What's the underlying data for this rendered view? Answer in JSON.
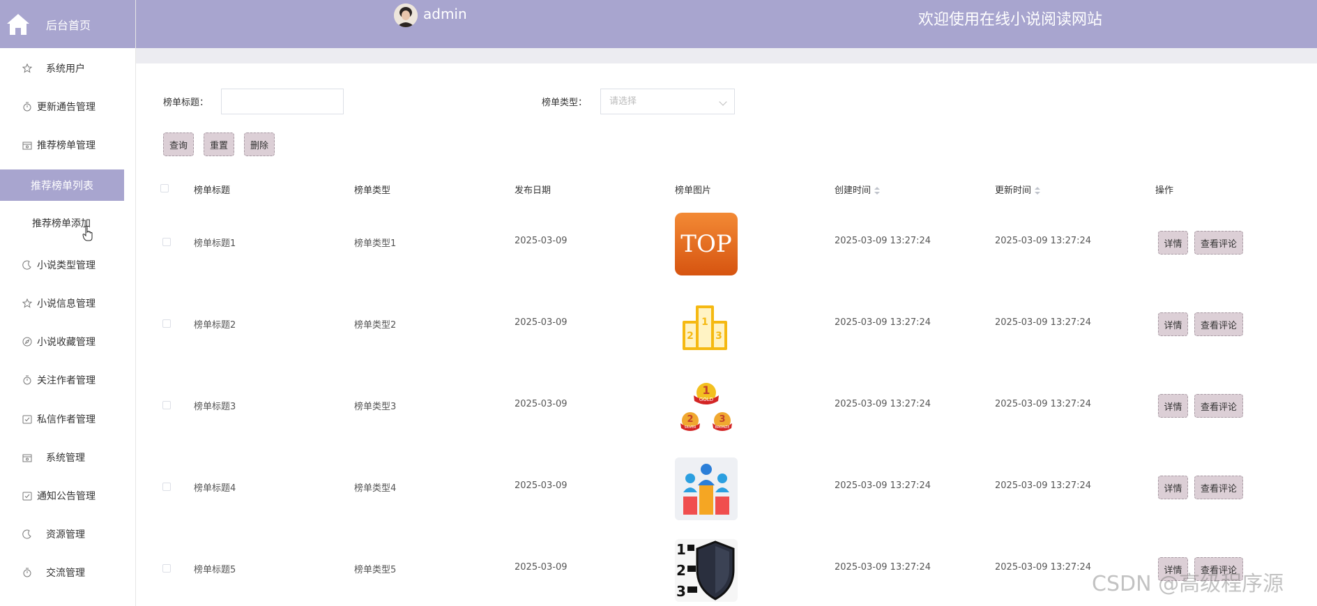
{
  "colors": {
    "accent": "#a8a5cf",
    "button_bg": "#dccfd6",
    "header_text": "#ffffff"
  },
  "logo": {
    "text": "后台首页",
    "icon": "home-icon"
  },
  "sidebar": {
    "items": [
      {
        "label": "系统用户",
        "icon": "star-icon"
      },
      {
        "label": "更新通告管理",
        "icon": "timer-icon"
      },
      {
        "label": "推荐榜单管理",
        "icon": "box-icon"
      },
      {
        "label": "小说类型管理",
        "icon": "moon-icon"
      },
      {
        "label": "小说信息管理",
        "icon": "star-icon"
      },
      {
        "label": "小说收藏管理",
        "icon": "compass-icon"
      },
      {
        "label": "关注作者管理",
        "icon": "timer-icon"
      },
      {
        "label": "私信作者管理",
        "icon": "checkbox-icon"
      },
      {
        "label": "系统管理",
        "icon": "box-icon"
      },
      {
        "label": "通知公告管理",
        "icon": "checkbox-icon"
      },
      {
        "label": "资源管理",
        "icon": "moon-icon"
      },
      {
        "label": "交流管理",
        "icon": "timer-icon"
      }
    ],
    "submenu": {
      "active": "推荐榜单列表",
      "other": "推荐榜单添加"
    }
  },
  "header": {
    "user": "admin",
    "welcome": "欢迎使用在线小说阅读网站"
  },
  "search": {
    "title_label": "榜单标题：",
    "title_value": "",
    "type_label": "榜单类型：",
    "type_placeholder": "请选择",
    "buttons": {
      "query": "查询",
      "reset": "重置",
      "delete": "删除"
    }
  },
  "table": {
    "headers": [
      "榜单标题",
      "榜单类型",
      "发布日期",
      "榜单图片",
      "创建时间",
      "更新时间",
      "操作"
    ],
    "rows": [
      {
        "title": "榜单标题1",
        "type": "榜单类型1",
        "date": "2025-03-09",
        "image": "top-badge",
        "created": "2025-03-09 13:27:24",
        "updated": "2025-03-09 13:27:24"
      },
      {
        "title": "榜单标题2",
        "type": "榜单类型2",
        "date": "2025-03-09",
        "image": "podium-outline",
        "created": "2025-03-09 13:27:24",
        "updated": "2025-03-09 13:27:24"
      },
      {
        "title": "榜单标题3",
        "type": "榜单类型3",
        "date": "2025-03-09",
        "image": "gold-medals",
        "created": "2025-03-09 13:27:24",
        "updated": "2025-03-09 13:27:24"
      },
      {
        "title": "榜单标题4",
        "type": "榜单类型4",
        "date": "2025-03-09",
        "image": "people-podium",
        "created": "2025-03-09 13:27:24",
        "updated": "2025-03-09 13:27:24"
      },
      {
        "title": "榜单标题5",
        "type": "榜单类型5",
        "date": "2025-03-09",
        "image": "ranked-shield",
        "created": "2025-03-09 13:27:24",
        "updated": "2025-03-09 13:27:24"
      }
    ],
    "actions": {
      "detail": "详情",
      "comments": "查看评论"
    }
  },
  "images": {
    "top_text": "TOP",
    "gold_text": "GOLD",
    "silver_text": "SILVER",
    "bronze_text": "BRONZE",
    "medal_numbers": [
      "1",
      "2",
      "3"
    ]
  },
  "watermark": "CSDN @高级程序源"
}
